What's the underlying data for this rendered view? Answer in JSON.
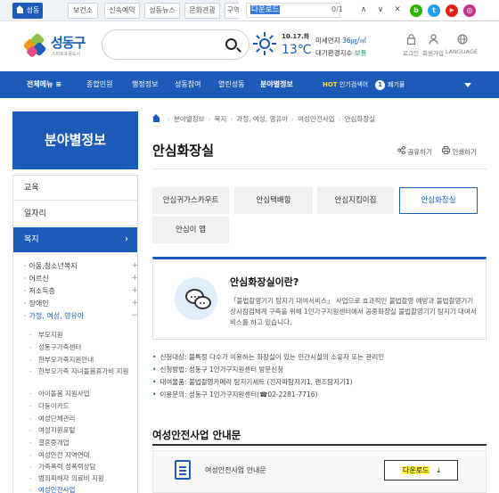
{
  "topbar": {
    "tabs": [
      {
        "label": "성동구청",
        "active": true
      },
      {
        "label": "보건소",
        "active": false
      },
      {
        "label": "신속예약",
        "active": false
      },
      {
        "label": "성동뉴스",
        "active": false
      },
      {
        "label": "문화관광",
        "active": false
      },
      {
        "label": "구역",
        "active": false
      }
    ]
  },
  "findbar": {
    "query": "다운로드",
    "count": "0/1",
    "up": "∧",
    "down": "∨",
    "close": "✕"
  },
  "social": [
    {
      "icon": "blog-icon",
      "glyph": "b",
      "color": "#2db400"
    },
    {
      "icon": "twitter-icon",
      "glyph": "t",
      "color": "#1da1f2"
    },
    {
      "icon": "youtube-icon",
      "glyph": "▶",
      "color": "#e62117"
    },
    {
      "icon": "instagram-icon",
      "glyph": "◎",
      "color": "#c13584"
    }
  ],
  "header": {
    "logo_name": "성동구",
    "logo_slogan": "스마트포용도시",
    "search_placeholder": "",
    "weather": {
      "date": "10.17.화",
      "temp": "13℃",
      "dust_label": "미세먼지",
      "dust_value": "36㎍/㎥",
      "air_label": "대기환경지수",
      "air_value": "보통"
    },
    "utils": [
      {
        "label": "로그인",
        "icon": "lock-icon"
      },
      {
        "label": "회원가입",
        "icon": "user-icon"
      },
      {
        "label": "LANGUAGE",
        "icon": "globe-icon"
      }
    ]
  },
  "nav": {
    "all_menu": "전체메뉴",
    "items": [
      "종합민원",
      "행정정보",
      "성동참여",
      "열린성동",
      "분야별정보"
    ],
    "hot_label": "HOT",
    "hot_text": "인기검색어",
    "hot_num": "1",
    "hot_word": "폐기물"
  },
  "sidebar": {
    "title": "분야별정보",
    "items": [
      "교육",
      "일자리",
      "복지"
    ],
    "active_arrow": "›",
    "sub": [
      {
        "label": "아동,청소년복지",
        "active": false
      },
      {
        "label": "어르신",
        "active": false
      },
      {
        "label": "저소득층",
        "active": false
      },
      {
        "label": "장애인",
        "active": false
      },
      {
        "label": "가정, 여성, 영유아",
        "active": true
      }
    ],
    "plus": "+",
    "minus": "−",
    "sub3": [
      "부모지원",
      "성동구가족센터",
      "한부모가족지원안내",
      "한부모가족 자녀돌봄휴가비 지원",
      "아이돌봄 지원사업",
      "다둥이카드",
      "여성단체관리",
      "여성지원포털",
      "결혼중개업",
      "여성안전 지역연대",
      "가족폭력 성폭력상담",
      "범죄피해자 의료비 지원",
      "여성안전사업"
    ]
  },
  "breadcrumb": [
    "분야별정보",
    "복지",
    "가정, 여성, 영유아",
    "여성안전사업",
    "안심화장실"
  ],
  "page": {
    "title": "안심화장실",
    "share": "공유하기",
    "print": "인쇄하기"
  },
  "tabs": [
    {
      "label": "안심귀가스카우트",
      "active": false
    },
    {
      "label": "안심택배함",
      "active": false
    },
    {
      "label": "안심지킴이집",
      "active": false
    },
    {
      "label": "안심화장실",
      "active": true
    },
    {
      "label": "안심이 앱",
      "active": false
    }
  ],
  "info": {
    "title": "안심화장실이란?",
    "text": "「불법촬영기기 탐지기 대여서비스」 사업으로 효과적인 불법촬영 예방과 불법촬영기기 상시점검체계 구축을 위해 1인가구지원센터에서 공중화장실 불법촬영기기 탐지기 대여서비스를 하고 있습니다."
  },
  "bullets": [
    "신청대상: 불특정 다수가 이용하는 화장실이 있는 민간시설의 소유자 또는 관리인",
    "신청방법: 성동구 1인가구지원센터 방문신청",
    "대여물품: 불법촬영카메라 탐지기세트 (전자파탐지기1, 렌즈탐지기1)",
    "이용문의: 성동구 1인가구지원센터(☎02-2281-7716)"
  ],
  "section": {
    "title": "여성안전사업 안내문",
    "file": "여성안전사업 안내문",
    "download": "다운로드",
    "download_icon": "⤓"
  }
}
